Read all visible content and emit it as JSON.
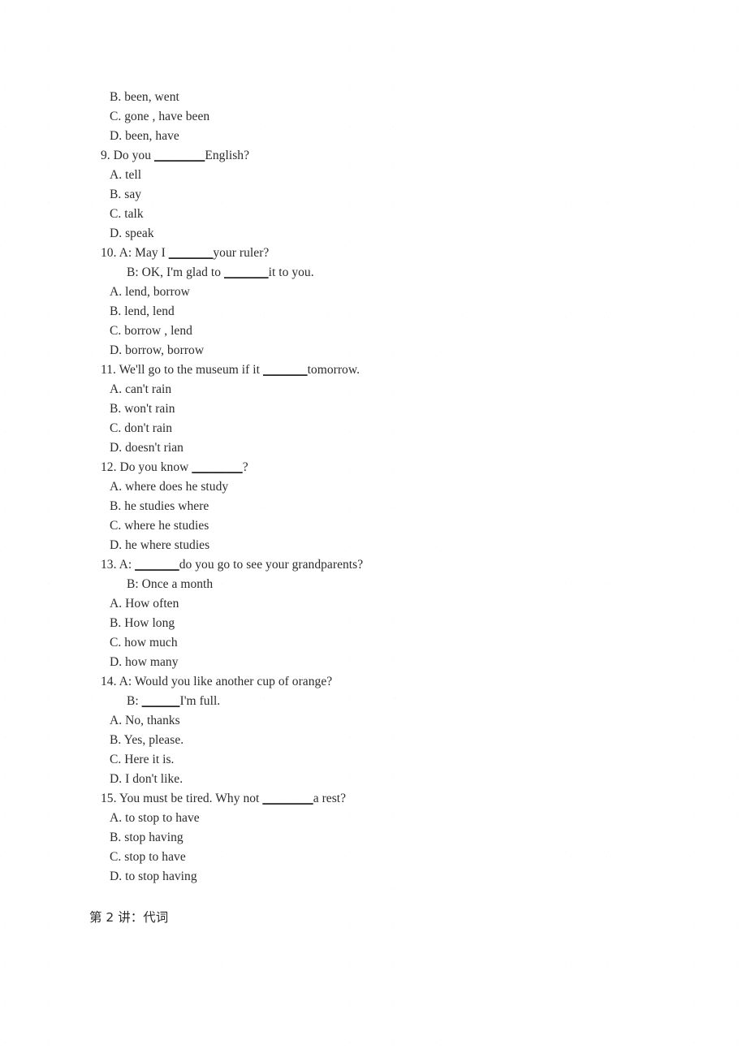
{
  "document": {
    "lines": [
      {
        "indent": "opt",
        "text": "B. been, went"
      },
      {
        "indent": "opt",
        "text": "C. gone , have been"
      },
      {
        "indent": "opt",
        "text": "D. been, have"
      },
      {
        "indent": "q",
        "text": "9. Do you ",
        "blank": "________",
        "tail": "English?"
      },
      {
        "indent": "opt",
        "text": "A. tell"
      },
      {
        "indent": "opt",
        "text": "B. say"
      },
      {
        "indent": "opt",
        "text": "C. talk"
      },
      {
        "indent": "opt",
        "text": "D. speak"
      },
      {
        "indent": "q",
        "text": "10. A: May I ",
        "blank": "_______",
        "tail": "your ruler?"
      },
      {
        "indent": "cont",
        "text": "B: OK, I'm glad to ",
        "blank": "_______",
        "tail": "it to you."
      },
      {
        "indent": "opt",
        "text": "A. lend, borrow"
      },
      {
        "indent": "opt",
        "text": "B. lend, lend"
      },
      {
        "indent": "opt",
        "text": "C. borrow , lend"
      },
      {
        "indent": "opt",
        "text": "D. borrow, borrow"
      },
      {
        "indent": "q",
        "text": "11. We'll go to the museum if it ",
        "blank": "_______",
        "tail": "tomorrow."
      },
      {
        "indent": "opt",
        "text": "A. can't rain"
      },
      {
        "indent": "opt",
        "text": "B. won't rain"
      },
      {
        "indent": "opt",
        "text": "C. don't rain"
      },
      {
        "indent": "opt",
        "text": "D. doesn't rian"
      },
      {
        "indent": "q",
        "text": "12. Do you know ",
        "blank": "________",
        "tail": "?"
      },
      {
        "indent": "opt",
        "text": "A. where does he study"
      },
      {
        "indent": "opt",
        "text": "B. he studies where"
      },
      {
        "indent": "opt",
        "text": "C. where he studies"
      },
      {
        "indent": "opt",
        "text": "D. he where studies"
      },
      {
        "indent": "q",
        "text": "13. A: ",
        "blank": "_______",
        "tail": "do you go to see your grandparents?"
      },
      {
        "indent": "cont",
        "text": "B: Once a month"
      },
      {
        "indent": "opt",
        "text": "A. How often"
      },
      {
        "indent": "opt",
        "text": "B. How long"
      },
      {
        "indent": "opt",
        "text": "C. how much"
      },
      {
        "indent": "opt",
        "text": "D. how many"
      },
      {
        "indent": "q",
        "text": "14. A: Would you like another cup of orange?"
      },
      {
        "indent": "cont",
        "text": "B: ",
        "blank": "______",
        "tail": "I'm full."
      },
      {
        "indent": "opt",
        "text": "A. No, thanks"
      },
      {
        "indent": "opt",
        "text": "B. Yes, please."
      },
      {
        "indent": "opt",
        "text": "C. Here it is."
      },
      {
        "indent": "opt",
        "text": "D. I don't like."
      },
      {
        "indent": "q",
        "text": "15. You must be tired. Why not ",
        "blank": "________",
        "tail": "a rest?"
      },
      {
        "indent": "opt",
        "text": "A. to stop to have"
      },
      {
        "indent": "opt",
        "text": "B. stop having"
      },
      {
        "indent": "opt",
        "text": "C. stop to have"
      },
      {
        "indent": "opt",
        "text": "D. to stop having"
      }
    ],
    "footer": "第 2 讲：代词"
  }
}
